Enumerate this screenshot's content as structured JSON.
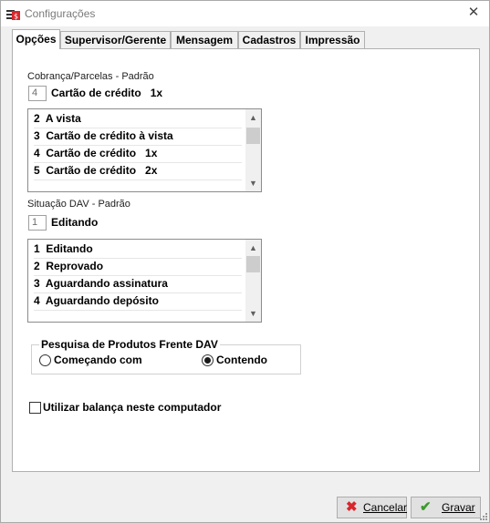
{
  "window": {
    "title": "Configurações"
  },
  "tabs": [
    {
      "label": "Opções",
      "active": true
    },
    {
      "label": "Supervisor/Gerente",
      "active": false
    },
    {
      "label": "Mensagem",
      "active": false
    },
    {
      "label": "Cadastros",
      "active": false
    },
    {
      "label": "Impressão",
      "active": false
    }
  ],
  "cobranca": {
    "label": "Cobrança/Parcelas - Padrão",
    "code": "4",
    "selected": "Cartão de crédito   1x",
    "items": [
      "2  A vista",
      "3  Cartão de crédito à vista",
      "4  Cartão de crédito   1x",
      "5  Cartão de crédito   2x"
    ]
  },
  "situacao": {
    "label": "Situação DAV - Padrão",
    "code": "1",
    "selected": "Editando",
    "items": [
      "1  Editando",
      "2  Reprovado",
      "3  Aguardando assinatura",
      "4  Aguardando depósito"
    ]
  },
  "pesquisa": {
    "title": "Pesquisa de Produtos Frente DAV",
    "option_start": "Começando com",
    "option_contains": "Contendo",
    "selected": "contains"
  },
  "balanca": {
    "label": "Utilizar balança neste computador",
    "checked": false
  },
  "buttons": {
    "cancel": "Cancelar",
    "save": "Gravar"
  },
  "colors": {
    "cancel_icon": "#d9262c",
    "save_icon": "#3e9a2c"
  }
}
